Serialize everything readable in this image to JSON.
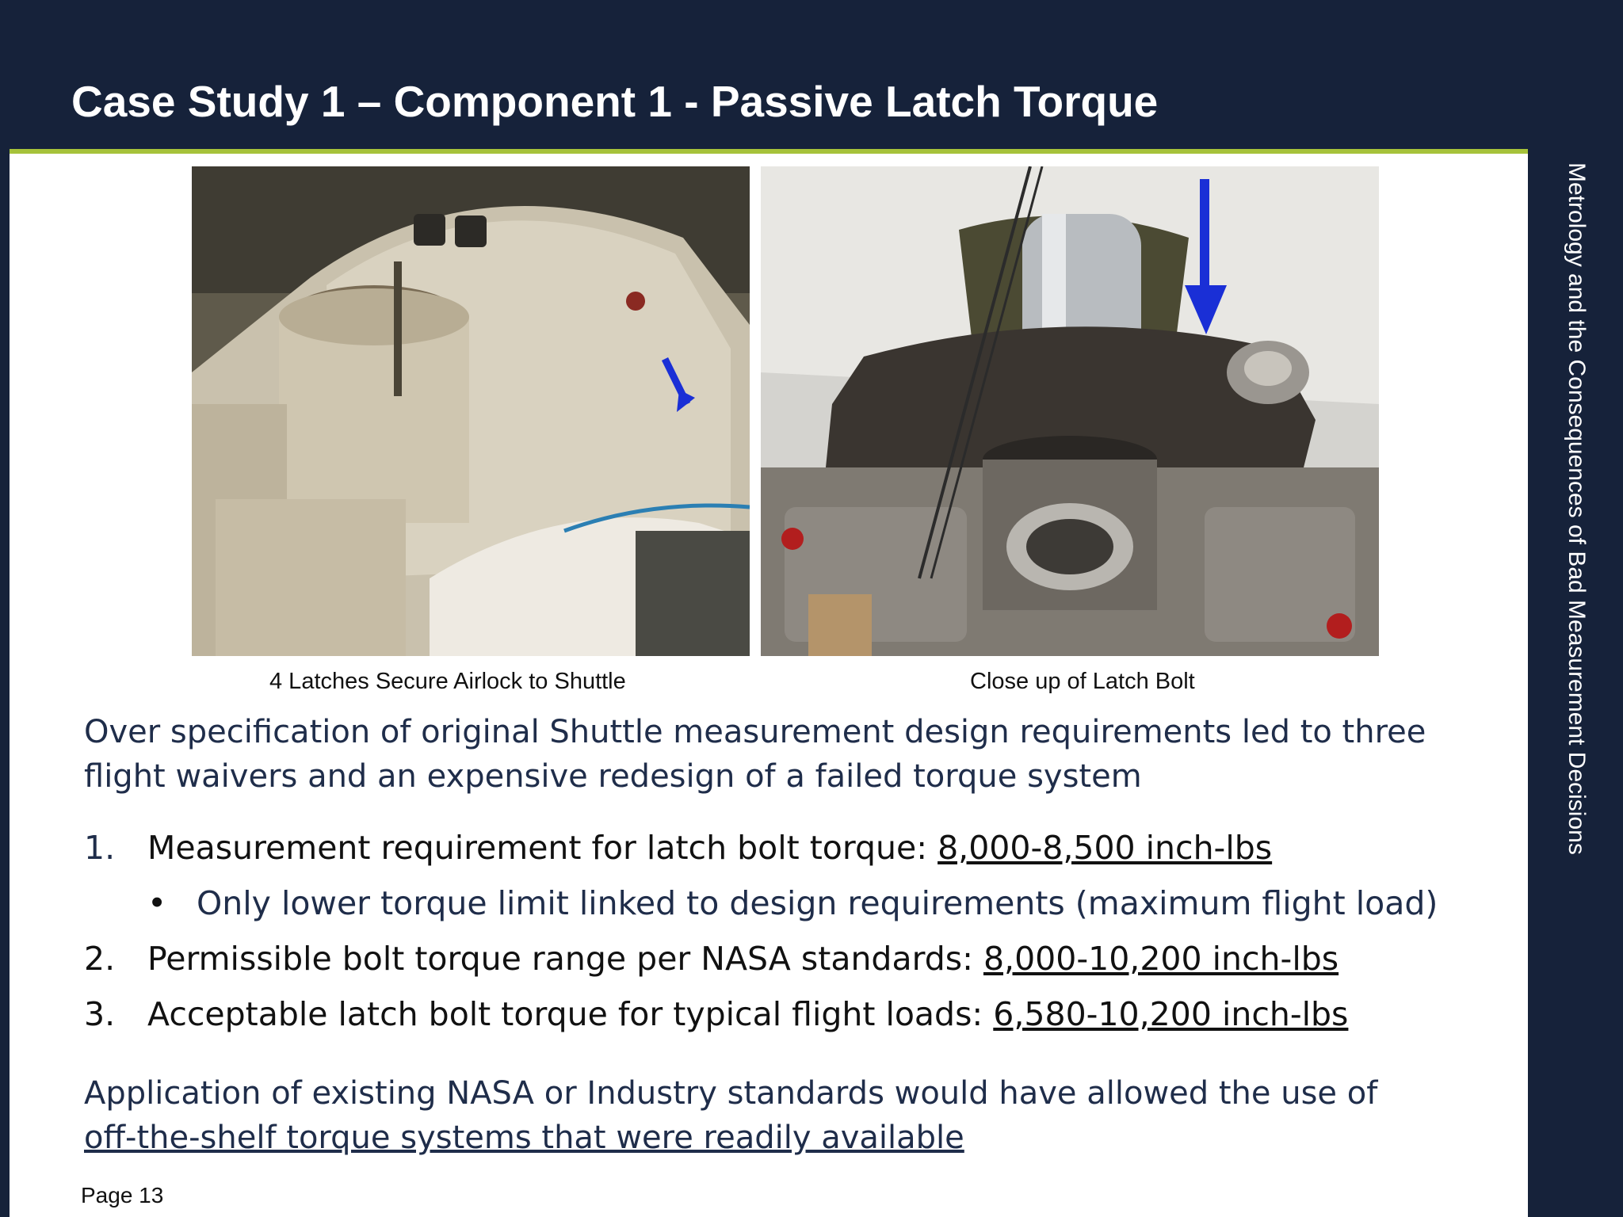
{
  "slide": {
    "title": "Case Study 1 – Component 1 - Passive Latch Torque",
    "side_title": "Metrology and the Consequences of Bad Measurement Decisions",
    "page": "Page 13"
  },
  "photos": {
    "left_caption": "4 Latches Secure Airlock to Shuttle",
    "right_caption": "Close up of Latch Bolt"
  },
  "intro": "Over specification of original Shuttle measurement design requirements led to three flight waivers and an expensive redesign of a failed torque system",
  "list": [
    {
      "num": "1.",
      "text": "Measurement requirement for latch bolt torque: ",
      "value": "8,000-8,500 inch-lbs"
    },
    {
      "bullet": "•",
      "text": "Only lower torque limit linked to design requirements (maximum flight load)"
    },
    {
      "num": "2.",
      "text": "Permissible bolt torque range per NASA standards: ",
      "value": "8,000-10,200 inch-lbs"
    },
    {
      "num": "3.",
      "text": "Acceptable latch bolt torque for typical flight loads: ",
      "value": "6,580-10,200 inch-lbs"
    }
  ],
  "conclusion": {
    "text": "Application of existing NASA or Industry standards would have allowed the use of ",
    "underlined": "off-the-shelf torque systems that were readily available"
  },
  "colors": {
    "frame": "#16223a",
    "accent": "#a6c23a",
    "arrow": "#1a2fd6"
  }
}
